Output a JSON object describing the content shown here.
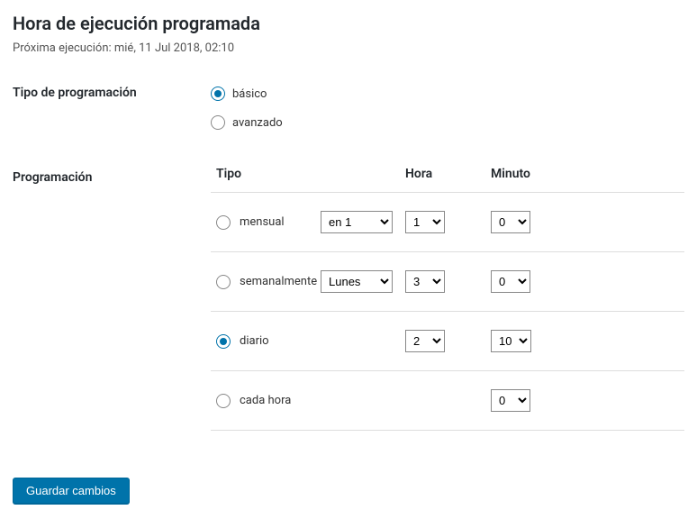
{
  "title": "Hora de ejecución programada",
  "next_run_label": "Próxima ejecución: mié, 11 Jul 2018, 02:10",
  "labels": {
    "tipo_programacion": "Tipo de programación",
    "programacion": "Programación"
  },
  "sched_type": {
    "basico": "básico",
    "avanzado": "avanzado",
    "selected": "basico"
  },
  "sched_table": {
    "headers": {
      "tipo": "Tipo",
      "hora": "Hora",
      "minuto": "Minuto"
    },
    "rows": {
      "mensual": {
        "label": "mensual",
        "selected": false,
        "day": "en 1",
        "hora": "1",
        "minuto": "0"
      },
      "semanalmente": {
        "label": "semanalmente",
        "selected": false,
        "day": "Lunes",
        "hora": "3",
        "minuto": "0"
      },
      "diario": {
        "label": "diario",
        "selected": true,
        "hora": "2",
        "minuto": "10"
      },
      "cada_hora": {
        "label": "cada hora",
        "selected": false,
        "minuto": "0"
      }
    }
  },
  "button": {
    "save": "Guardar cambios"
  }
}
